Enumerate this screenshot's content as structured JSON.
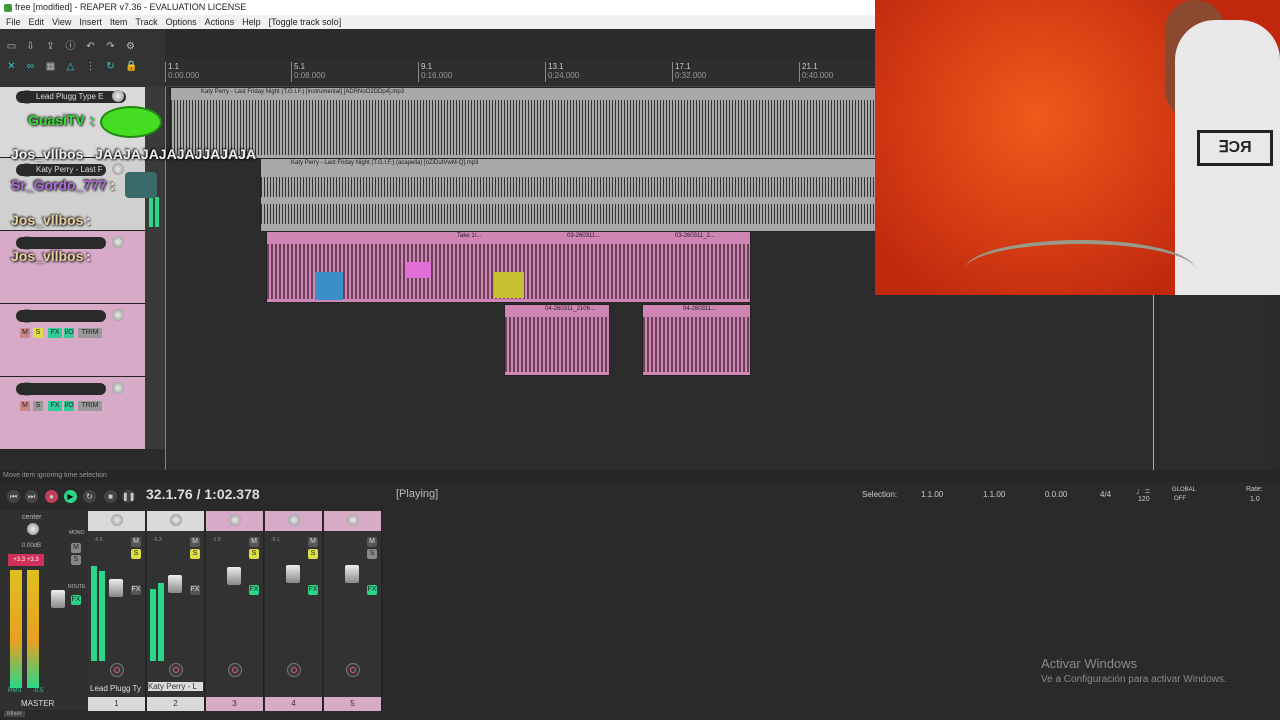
{
  "window": {
    "title": "free [modified] - REAPER v7.36 - EVALUATION LICENSE"
  },
  "menu": [
    "File",
    "Edit",
    "View",
    "Insert",
    "Item",
    "Track",
    "Options",
    "Actions",
    "Help",
    "[Toggle track solo]"
  ],
  "ruler": {
    "marks": [
      {
        "bar": "1.1",
        "time": "0:00.000"
      },
      {
        "bar": "5.1",
        "time": "0:08.000"
      },
      {
        "bar": "9.1",
        "time": "0:16.000"
      },
      {
        "bar": "13.1",
        "time": "0:24.000"
      },
      {
        "bar": "17.1",
        "time": "0:32.000"
      },
      {
        "bar": "21.1",
        "time": "0:40.000"
      }
    ]
  },
  "tracks": [
    {
      "name": "Lead Plugg Type E",
      "number": "1"
    },
    {
      "name": "Katy Perry - Last F",
      "number": "2"
    },
    {
      "name": "",
      "number": "3"
    },
    {
      "name": "",
      "number": "4"
    },
    {
      "name": "",
      "number": "5"
    }
  ],
  "track_buttons": {
    "mute": "M",
    "solo": "S",
    "fx": "FX",
    "io": "I/O",
    "trim": "TRIM"
  },
  "items": {
    "instrumental": "Katy Perry - Last Friday Night (T.G.I.F.) [instrumental] [ADRNoO2DDp4].mp3",
    "acapella": "Katy Perry - Last Friday Night (T.G.I.F.) (acapella) [oZiDutVwM-Q].mp3",
    "take": "Take 1/...",
    "rec1": "03-260311...",
    "rec2": "03-260311_2...",
    "rec3": "04-260311_2106...",
    "rec4": "04-260311..."
  },
  "chat": [
    {
      "user": "GuasiTV",
      "text": ":"
    },
    {
      "user": "Jos_vllbos",
      "text": "JAAJAJAJAJAJJAJAJA"
    },
    {
      "user": "Sr_Gordo_777",
      "text": ":"
    },
    {
      "user": "Jos_vllbos",
      "text": ":"
    },
    {
      "user": "Jos_vllbos",
      "text": ":"
    }
  ],
  "status": {
    "message": "Move item ignoring time selection"
  },
  "transport": {
    "position": "32.1.76 / 1:02.378",
    "state": "[Playing]",
    "selection_label": "Selection:",
    "selection_start": "1.1.00",
    "selection_end": "1.1.00",
    "selection_length": "0.0.00",
    "time_signature": "4/4",
    "bpm": "120",
    "global": "GLOBAL",
    "global_state": "OFF",
    "rate_label": "Rate:",
    "rate": "1.0"
  },
  "mixer": {
    "master_label": "MASTER",
    "master_pan": "center",
    "master_db": "0.00dB",
    "master_peak_l": "+3.3",
    "master_peak_r": "+3.3",
    "rms_label": "RMS",
    "rms_value": "-0.5",
    "mono": "MONO",
    "route": "ROUTE",
    "strips": [
      {
        "name": "Lead Plugg Ty",
        "number": "1",
        "db": "-6.6",
        "meter": 0.55
      },
      {
        "name": "Katy Perry - L",
        "number": "2",
        "db": "-6.3",
        "meter": 0.6
      },
      {
        "name": "",
        "number": "3",
        "db": "-1.5",
        "meter": 0.0
      },
      {
        "name": "",
        "number": "4",
        "db": "-0.1",
        "meter": 0.0
      },
      {
        "name": "",
        "number": "5",
        "db": "",
        "meter": 0.0
      }
    ],
    "tab_label": "Mixer"
  },
  "watermark": {
    "line1": "Activar Windows",
    "line2": "Ve a Configuración para activar Windows."
  },
  "colors": {
    "track_pink": "#d7aac8",
    "item_pink": "#cf86b4",
    "meter_green": "#2ad68a",
    "webcam_bg": "#e04414"
  }
}
